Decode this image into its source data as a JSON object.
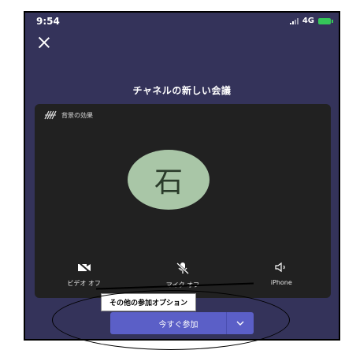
{
  "status_bar": {
    "time": "9:54",
    "network": "4G"
  },
  "meeting": {
    "title": "チャネルの新しい会議"
  },
  "preview": {
    "background_effects_label": "背景の効果",
    "avatar_initial": "石"
  },
  "controls": [
    {
      "icon": "video-off-icon",
      "label": "ビデオ オフ"
    },
    {
      "icon": "mic-off-icon",
      "label": "マイク オフ"
    },
    {
      "icon": "speaker-icon",
      "label": "iPhone"
    }
  ],
  "more_options": {
    "label": "その他の参加オプション"
  },
  "join": {
    "label": "今すぐ参加"
  },
  "colors": {
    "background": "#34335a",
    "preview": "#212121",
    "avatar": "#a9c6a7",
    "accent": "#5b5fc7",
    "battery": "#35c759"
  }
}
